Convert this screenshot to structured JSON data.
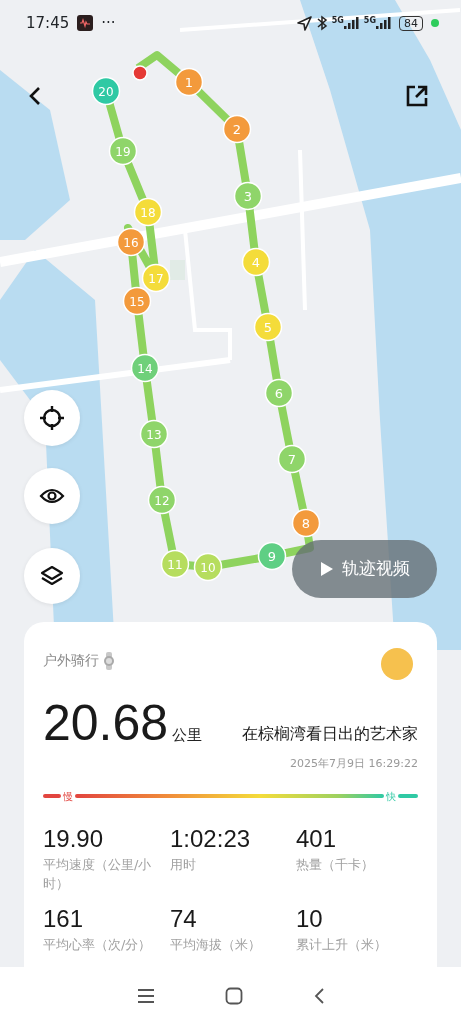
{
  "status_bar": {
    "time": "17:45",
    "more": "···",
    "signals": [
      {
        "label": "5G"
      },
      {
        "label": "5G"
      }
    ],
    "battery": "84"
  },
  "map": {
    "markers": [
      {
        "label": "1",
        "color": "#f39a3c"
      },
      {
        "label": "2",
        "color": "#f39a3c"
      },
      {
        "label": "3",
        "color": "#8fd56a"
      },
      {
        "label": "4",
        "color": "#f4dc3a"
      },
      {
        "label": "5",
        "color": "#f4dc3a"
      },
      {
        "label": "6",
        "color": "#8fd56a"
      },
      {
        "label": "7",
        "color": "#8fd56a"
      },
      {
        "label": "8",
        "color": "#f39a3c"
      },
      {
        "label": "9",
        "color": "#5fcf84"
      },
      {
        "label": "10",
        "color": "#b6dd5e"
      },
      {
        "label": "11",
        "color": "#b6dd5e"
      },
      {
        "label": "12",
        "color": "#8fd56a"
      },
      {
        "label": "13",
        "color": "#8fd56a"
      },
      {
        "label": "14",
        "color": "#6fd07a"
      },
      {
        "label": "15",
        "color": "#f39a3c"
      },
      {
        "label": "16",
        "color": "#f39a3c"
      },
      {
        "label": "17",
        "color": "#f4dc3a"
      },
      {
        "label": "18",
        "color": "#f4dc3a"
      },
      {
        "label": "19",
        "color": "#8fd56a"
      },
      {
        "label": "20",
        "color": "#2fc9a4"
      }
    ],
    "video_button": "轨迹视频"
  },
  "card": {
    "sport": "户外骑行",
    "distance": "20.68",
    "unit": "公里",
    "title": "在棕榈湾看日出的艺术家",
    "datetime": "2025年7月9日 16:29:22",
    "pace_bar": {
      "slow": "慢",
      "fast": "快"
    },
    "stats": [
      {
        "value": "19.90",
        "label": "平均速度（公里/小时）"
      },
      {
        "value": "1:02:23",
        "label": "用时"
      },
      {
        "value": "401",
        "label": "热量（千卡）"
      },
      {
        "value": "161",
        "label": "平均心率（次/分）"
      },
      {
        "value": "74",
        "label": "平均海拔（米）"
      },
      {
        "value": "10",
        "label": "累计上升（米）"
      }
    ]
  }
}
